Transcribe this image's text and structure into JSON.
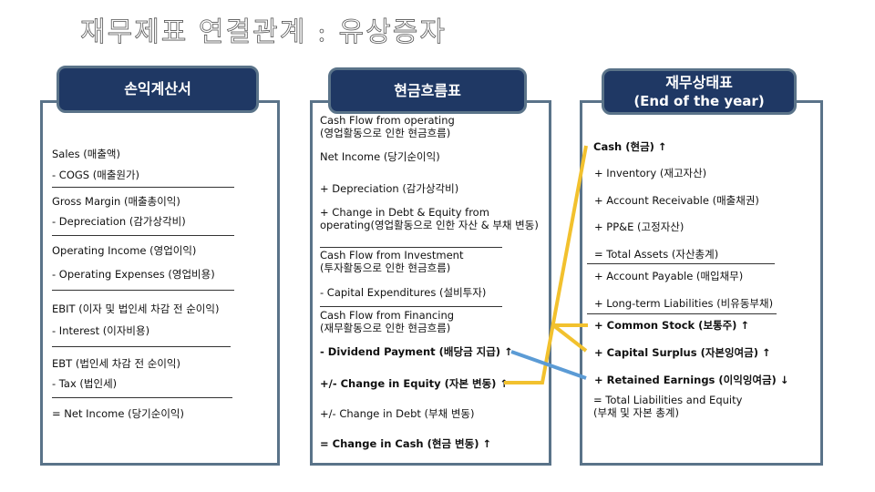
{
  "title": "재무제표 연결관계 : 유상증자",
  "income_statement": {
    "header": "손익계산서",
    "lines": [
      "Sales (매출액)",
      "- COGS (매출원가)",
      "Gross Margin (매출총이익)",
      "- Depreciation (감가상각비)",
      "Operating Income (영업이익)",
      "- Operating Expenses (영업비용)",
      "EBIT (이자 및 법인세 차감 전 순이익)",
      "- Interest (이자비용)",
      "EBT (법인세 차감 전 순이익)",
      "- Tax (법인세)",
      "= Net Income (당기순이익)"
    ]
  },
  "cash_flow": {
    "header": "현금흐름표",
    "lines": [
      "Cash Flow from operating",
      "(영업활동으로 인한 현금흐름)",
      "Net Income (당기순이익)",
      "+ Depreciation (감가상각비)",
      "+ Change in Debt & Equity from operating(영업활동으로 인한 자산 & 부채 변동)",
      "Cash Flow from Investment",
      "(투자활동으로 인한 현금흐름)",
      "- Capital Expenditures (설비투자)",
      "Cash Flow from Financing",
      "(재무활동으로 인한 현금흐름)",
      "- Dividend Payment (배당금 지급) ↑",
      "+/- Change in Equity (자본 변동) ↑",
      "+/- Change in Debt (부채 변동)",
      "= Change in Cash (현금 변동) ↑"
    ]
  },
  "balance_sheet": {
    "header": "재무상태표",
    "subheader": "(End of the year)",
    "lines": [
      "Cash (현금) ↑",
      "+ Inventory (재고자산)",
      "+ Account Receivable (매출채권)",
      "+ PP&E (고정자산)",
      "= Total Assets (자산총계)",
      "+ Account Payable (매입채무)",
      "+ Long-term Liabilities (비유동부채)",
      "+ Common Stock (보통주) ↑",
      "+ Capital Surplus (자본잉여금) ↑",
      "+ Retained Earnings (이익잉여금) ↓",
      "= Total Liabilities and Equity",
      "(부채 및 자본 총계)"
    ]
  },
  "colors": {
    "header_fill": "#1f3864",
    "border": "#5a7389",
    "equity_link": "#f2c12e",
    "dividend_link": "#5b9bd5"
  }
}
